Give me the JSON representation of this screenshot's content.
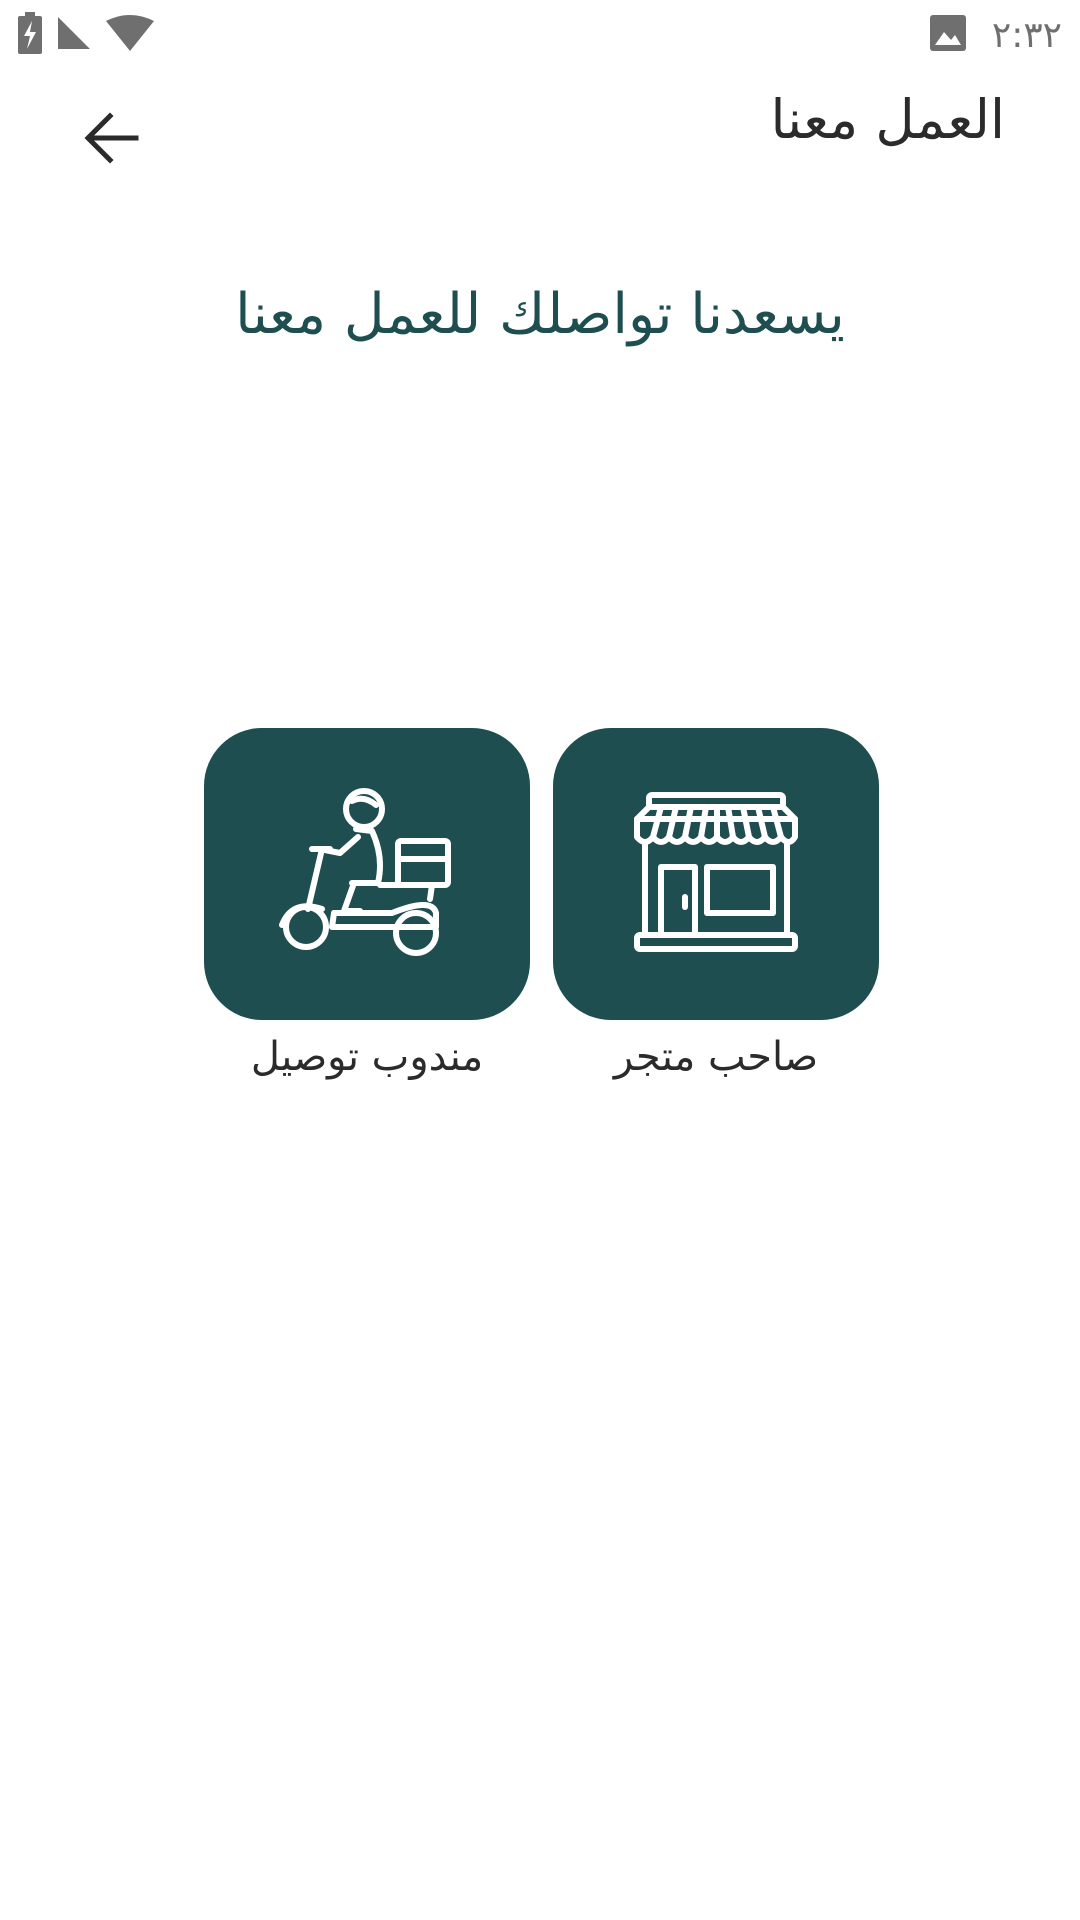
{
  "status_bar": {
    "time": "٢:٣٢",
    "icons": [
      "battery-charging-icon",
      "signal-icon",
      "wifi-icon",
      "image-notification-icon"
    ]
  },
  "app_bar": {
    "title": "العمل معنا",
    "back_icon": "arrow-back-icon"
  },
  "headline": "يسعدنا تواصلك للعمل معنا",
  "options": [
    {
      "label": "صاحب متجر",
      "icon": "storefront-icon"
    },
    {
      "label": "مندوب توصيل",
      "icon": "delivery-scooter-icon"
    }
  ],
  "colors": {
    "accent": "#1e4e50",
    "title_text": "#2b2b2b",
    "status_icons": "#6f6f6f",
    "background": "#ffffff"
  }
}
